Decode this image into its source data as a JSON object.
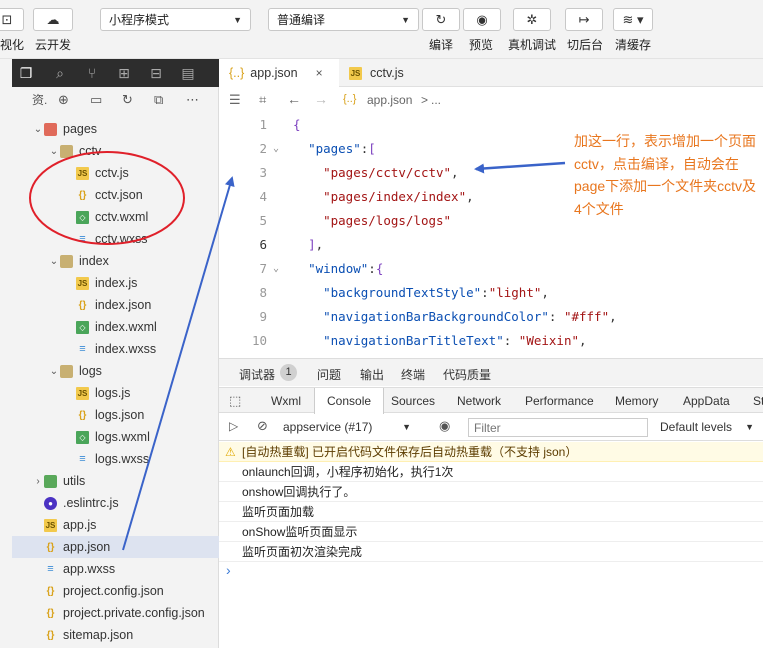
{
  "toolbar": {
    "left_btn1_label": "视化",
    "left_btn2_label": "云开发",
    "mode_select": "小程序模式",
    "compile_select": "普通编译",
    "compile_label": "编译",
    "preview_label": "预览",
    "device_debug_label": "真机调试",
    "background_label": "切后台",
    "clear_cache_label": "清缓存"
  },
  "explorer": {
    "header": "资."
  },
  "tree": [
    {
      "label": "pages",
      "icon": "folder-red",
      "depth": 0,
      "expanded": true
    },
    {
      "label": "cctv",
      "icon": "folder",
      "depth": 1,
      "expanded": true
    },
    {
      "label": "cctv.js",
      "icon": "js",
      "depth": 2
    },
    {
      "label": "cctv.json",
      "icon": "json",
      "depth": 2
    },
    {
      "label": "cctv.wxml",
      "icon": "wxml",
      "depth": 2
    },
    {
      "label": "cctv.wxss",
      "icon": "wxss",
      "depth": 2
    },
    {
      "label": "index",
      "icon": "folder",
      "depth": 1,
      "expanded": true
    },
    {
      "label": "index.js",
      "icon": "js",
      "depth": 2
    },
    {
      "label": "index.json",
      "icon": "json",
      "depth": 2
    },
    {
      "label": "index.wxml",
      "icon": "wxml",
      "depth": 2
    },
    {
      "label": "index.wxss",
      "icon": "wxss",
      "depth": 2
    },
    {
      "label": "logs",
      "icon": "folder",
      "depth": 1,
      "expanded": true
    },
    {
      "label": "logs.js",
      "icon": "js",
      "depth": 2
    },
    {
      "label": "logs.json",
      "icon": "json",
      "depth": 2
    },
    {
      "label": "logs.wxml",
      "icon": "wxml",
      "depth": 2
    },
    {
      "label": "logs.wxss",
      "icon": "wxss",
      "depth": 2
    },
    {
      "label": "utils",
      "icon": "folder-green",
      "depth": 0,
      "expanded": false
    },
    {
      "label": ".eslintrc.js",
      "icon": "eslint",
      "depth": 0
    },
    {
      "label": "app.js",
      "icon": "js",
      "depth": 0
    },
    {
      "label": "app.json",
      "icon": "json",
      "depth": 0,
      "selected": true
    },
    {
      "label": "app.wxss",
      "icon": "wxss",
      "depth": 0
    },
    {
      "label": "project.config.json",
      "icon": "json",
      "depth": 0
    },
    {
      "label": "project.private.config.json",
      "icon": "json",
      "depth": 0
    },
    {
      "label": "sitemap.json",
      "icon": "json",
      "depth": 0
    }
  ],
  "tabs": [
    {
      "label": "app.json",
      "icon": "{..}",
      "active": true,
      "close": "×"
    },
    {
      "label": "cctv.js",
      "icon": "JS",
      "active": false
    }
  ],
  "breadcrumb": {
    "file": "app.json",
    "sep": ">",
    "more": "..."
  },
  "code_lines": [
    {
      "n": "1",
      "fold": "",
      "tokens": [
        {
          "t": "{",
          "c": "br"
        }
      ]
    },
    {
      "n": "2",
      "fold": "⌄",
      "tokens": [
        {
          "t": "  ",
          "c": "p"
        },
        {
          "t": "\"pages\"",
          "c": "k"
        },
        {
          "t": ":",
          "c": "p"
        },
        {
          "t": "[",
          "c": "br"
        }
      ]
    },
    {
      "n": "3",
      "fold": "",
      "tokens": [
        {
          "t": "    ",
          "c": "p"
        },
        {
          "t": "\"pages/cctv/cctv\"",
          "c": "s"
        },
        {
          "t": ",",
          "c": "p"
        }
      ]
    },
    {
      "n": "4",
      "fold": "",
      "tokens": [
        {
          "t": "    ",
          "c": "p"
        },
        {
          "t": "\"pages/index/index\"",
          "c": "s"
        },
        {
          "t": ",",
          "c": "p"
        }
      ]
    },
    {
      "n": "5",
      "fold": "",
      "tokens": [
        {
          "t": "    ",
          "c": "p"
        },
        {
          "t": "\"pages/logs/logs\"",
          "c": "s"
        }
      ]
    },
    {
      "n": "6",
      "fold": "",
      "tokens": [
        {
          "t": "  ",
          "c": "p"
        },
        {
          "t": "]",
          "c": "br"
        },
        {
          "t": ",",
          "c": "p"
        }
      ],
      "current": true
    },
    {
      "n": "7",
      "fold": "⌄",
      "tokens": [
        {
          "t": "  ",
          "c": "p"
        },
        {
          "t": "\"window\"",
          "c": "k"
        },
        {
          "t": ":",
          "c": "p"
        },
        {
          "t": "{",
          "c": "br"
        }
      ]
    },
    {
      "n": "8",
      "fold": "",
      "tokens": [
        {
          "t": "    ",
          "c": "p"
        },
        {
          "t": "\"backgroundTextStyle\"",
          "c": "k"
        },
        {
          "t": ":",
          "c": "p"
        },
        {
          "t": "\"light\"",
          "c": "s"
        },
        {
          "t": ",",
          "c": "p"
        }
      ]
    },
    {
      "n": "9",
      "fold": "",
      "tokens": [
        {
          "t": "    ",
          "c": "p"
        },
        {
          "t": "\"navigationBarBackgroundColor\"",
          "c": "k"
        },
        {
          "t": ": ",
          "c": "p"
        },
        {
          "t": "\"#fff\"",
          "c": "s"
        },
        {
          "t": ",",
          "c": "p"
        }
      ]
    },
    {
      "n": "10",
      "fold": "",
      "tokens": [
        {
          "t": "    ",
          "c": "p"
        },
        {
          "t": "\"navigationBarTitleText\"",
          "c": "k"
        },
        {
          "t": ": ",
          "c": "p"
        },
        {
          "t": "\"Weixin\"",
          "c": "s"
        },
        {
          "t": ",",
          "c": "p"
        }
      ]
    }
  ],
  "annotation": "加这一行，表示增加一个页面cctv，点击编译，自动会在page下添加一个文件夹cctv及4个文件",
  "debug_tabs": [
    "调试器",
    "问题",
    "输出",
    "终端",
    "代码质量"
  ],
  "debug_badge": "1",
  "devtools_tabs": [
    "Wxml",
    "Console",
    "Sources",
    "Network",
    "Performance",
    "Memory",
    "AppData",
    "St"
  ],
  "console": {
    "context": "appservice (#17)",
    "filter_placeholder": "Filter",
    "levels": "Default levels",
    "prompt": "›",
    "lines": [
      {
        "text": "[自动热重载] 已开启代码文件保存后自动热重载（不支持 json）",
        "level": "warn"
      },
      {
        "text": "onlaunch回调，小程序初始化，执行1次",
        "level": "log"
      },
      {
        "text": "onshow回调执行了。",
        "level": "log"
      },
      {
        "text": "监听页面加载",
        "level": "log"
      },
      {
        "text": "onShow监听页面显示",
        "level": "log"
      },
      {
        "text": "监听页面初次渲染完成",
        "level": "log"
      }
    ]
  },
  "colors": {
    "annotation": "#e8761e",
    "arrow": "#3a63c9",
    "circle": "#e0202a",
    "selected_row": "#dde3f0"
  }
}
